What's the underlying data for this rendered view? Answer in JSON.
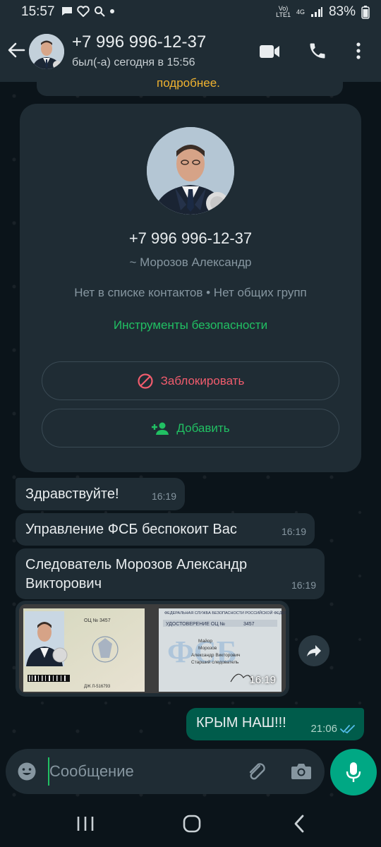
{
  "status_bar": {
    "time": "15:57",
    "network_top": "Vo)",
    "network_bottom": "LTE1",
    "network_type": "4G",
    "battery": "83%"
  },
  "header": {
    "contact_name": "+7 996 996-12-37",
    "last_seen": "был(-а) сегодня в 15:56"
  },
  "chat": {
    "previous_text": "подробнее.",
    "contact_card": {
      "phone": "+7 996 996-12-37",
      "display_name": "~ Морозов Александр",
      "info": "Нет в списке контактов • Нет общих групп",
      "safety_tools": "Инструменты безопасности",
      "block_label": "Заблокировать",
      "add_label": "Добавить"
    },
    "messages": [
      {
        "text": "Здравствуйте!",
        "time": "16:19"
      },
      {
        "text": "Управление ФСБ беспокоит Вас",
        "time": "16:19"
      },
      {
        "text": "Следователь Морозов Александр Викторович",
        "time": "16:19"
      }
    ],
    "image_message": {
      "time": "16:19",
      "id_header": "ФЕДЕРАЛЬНАЯ СЛУЖБА БЕЗОПАСНОСТИ РОССИЙСКОЙ ФЕДЕРАЦИИ",
      "id_title": "УДОСТОВЕРЕНИЕ  ОЦ №",
      "id_number": "3457",
      "id_left_number": "ОЦ №   3457",
      "id_left_serial": "ДЖ Л-516793",
      "id_surname": "Майор",
      "id_name1": "Морозов",
      "id_name2": "Александр Викторович",
      "id_role": "Старший следователь",
      "id_watermark": "ФСБ"
    },
    "outgoing": {
      "text": "КРЫМ НАШ!!!",
      "time": "21:06"
    }
  },
  "input": {
    "placeholder": "Сообщение"
  },
  "colors": {
    "accent": "#21c063",
    "danger": "#f15c6d",
    "outgoing_bubble": "#005c4b",
    "incoming_bubble": "#1f2c34"
  },
  "icons": [
    "back-arrow-icon",
    "video-call-icon",
    "phone-icon",
    "more-vertical-icon",
    "block-icon",
    "add-person-icon",
    "forward-icon",
    "double-check-icon",
    "emoji-icon",
    "attach-icon",
    "camera-icon",
    "mic-icon"
  ]
}
